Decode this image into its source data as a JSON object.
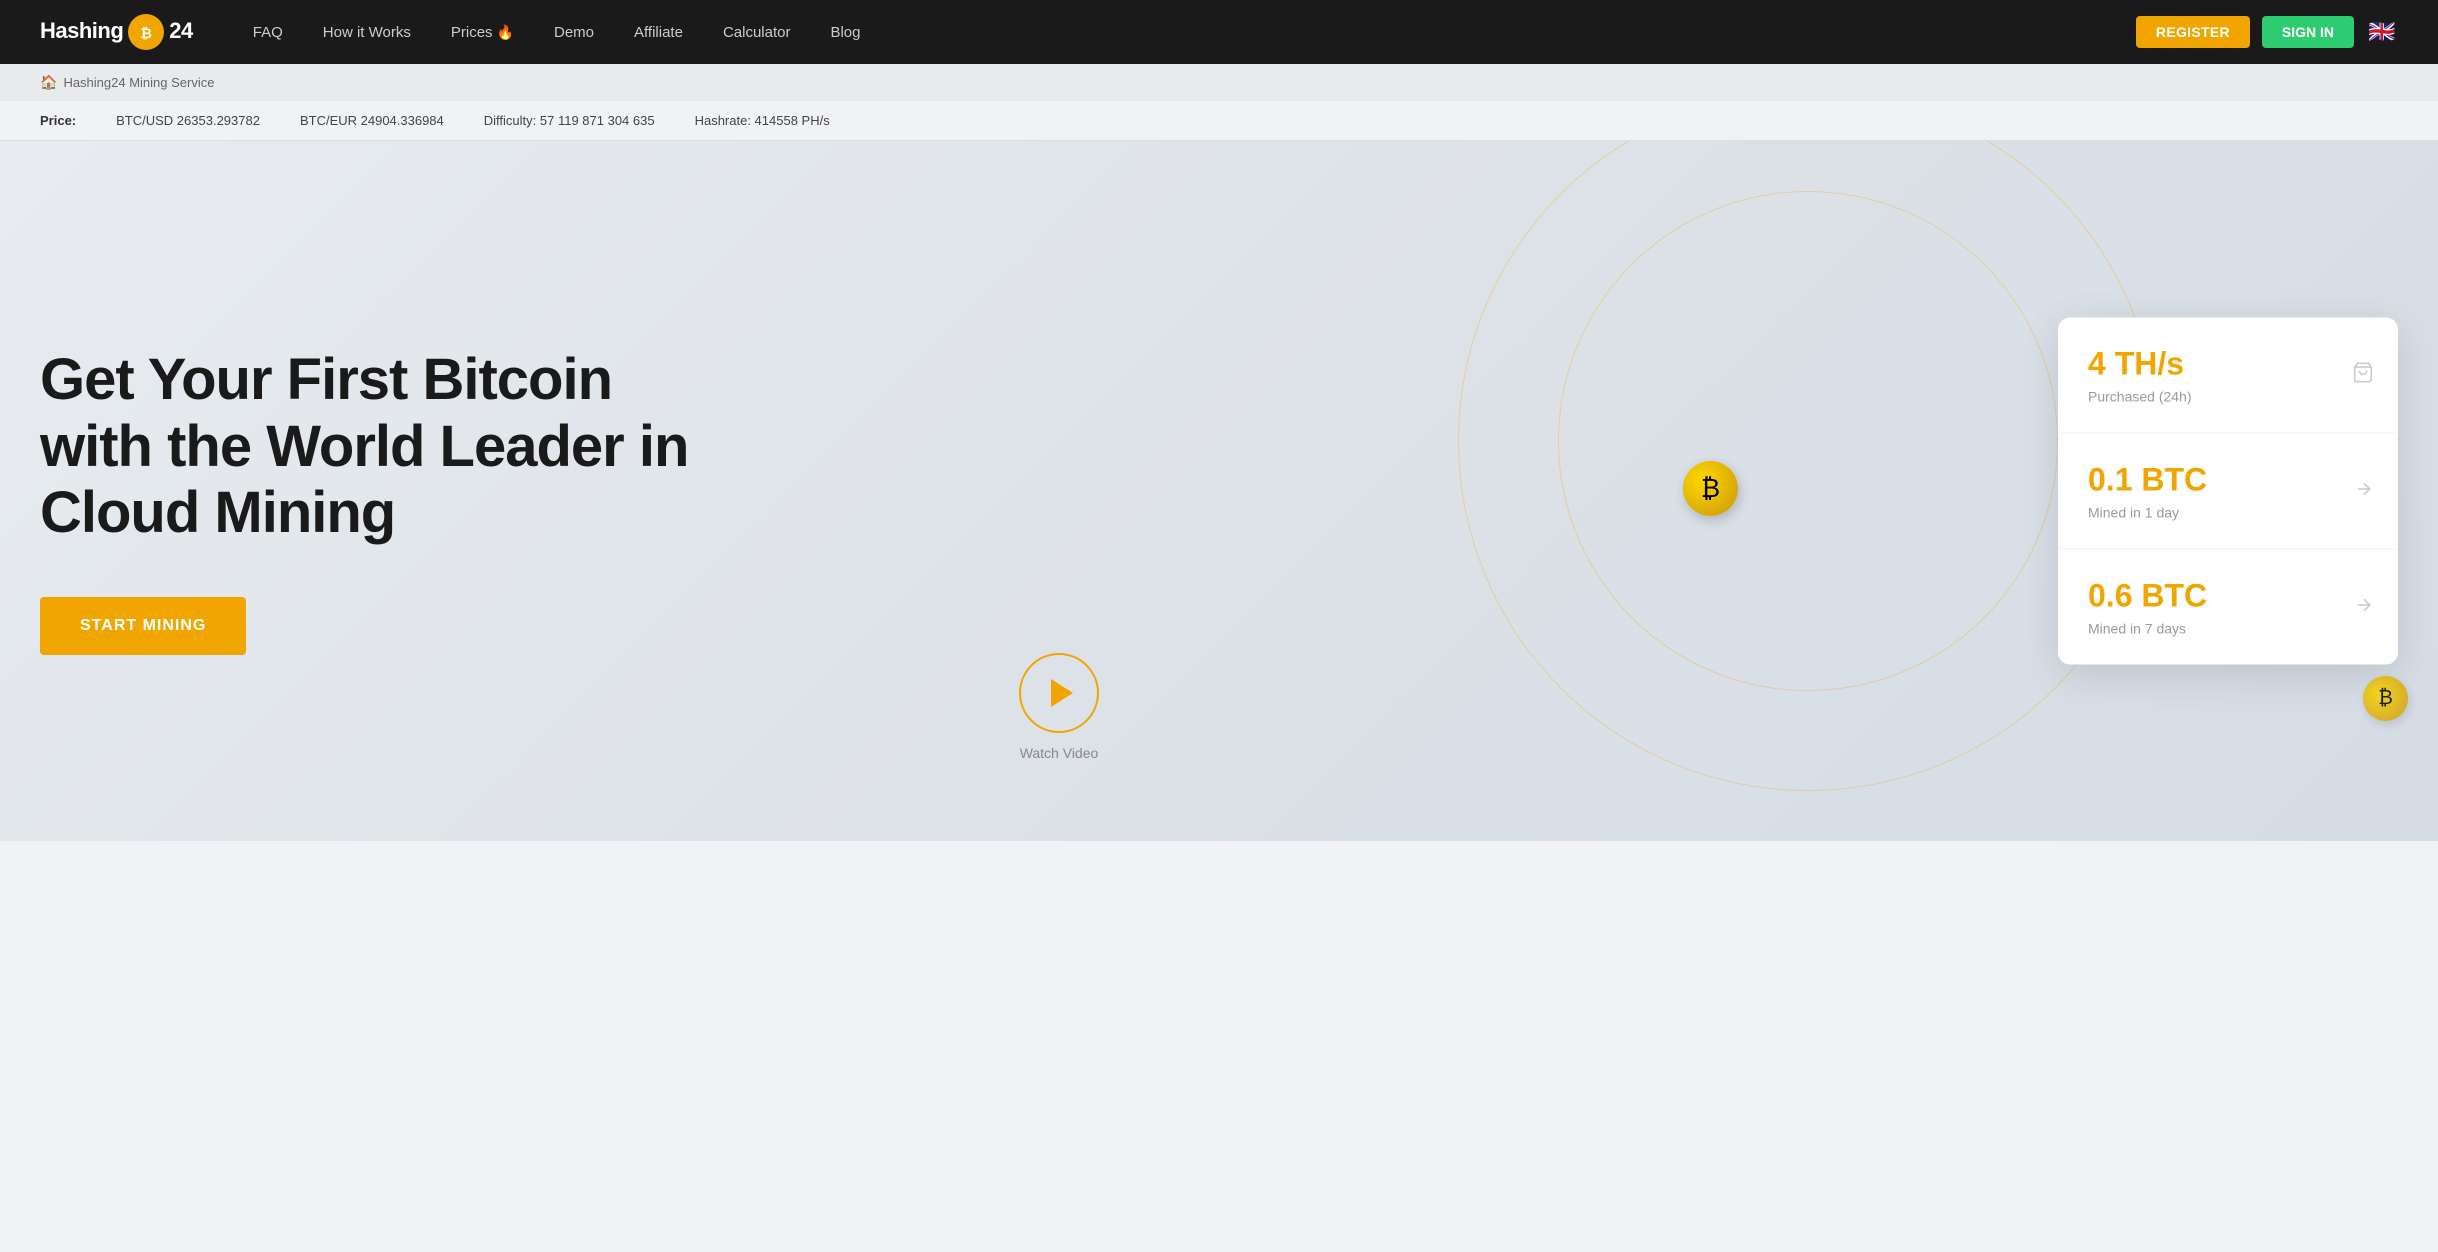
{
  "navbar": {
    "logo_text": "Hashing",
    "logo_suffix": "24",
    "nav_links": [
      {
        "id": "faq",
        "label": "FAQ",
        "has_fire": false
      },
      {
        "id": "how-it-works",
        "label": "How it Works",
        "has_fire": false
      },
      {
        "id": "prices",
        "label": "Prices",
        "has_fire": true
      },
      {
        "id": "demo",
        "label": "Demo",
        "has_fire": false
      },
      {
        "id": "affiliate",
        "label": "Affiliate",
        "has_fire": false
      },
      {
        "id": "calculator",
        "label": "Calculator",
        "has_fire": false
      },
      {
        "id": "blog",
        "label": "Blog",
        "has_fire": false
      }
    ],
    "register_label": "REGISTER",
    "signin_label": "SIGN IN",
    "lang_flag": "🇬🇧"
  },
  "breadcrumb": {
    "home_text": "Hashing24 Mining Service"
  },
  "ticker": {
    "price_label": "Price:",
    "btc_usd": "BTC/USD 26353.293782",
    "btc_eur": "BTC/EUR 24904.336984",
    "difficulty": "Difficulty: 57 119 871 304 635",
    "hashrate": "Hashrate: 414558 PH/s"
  },
  "hero": {
    "title_line1": "Get Your First Bitcoin",
    "title_line2": "with the World Leader in",
    "title_line3": "Cloud Mining",
    "start_button": "START MINING",
    "watch_video": "Watch Video"
  },
  "stats": [
    {
      "value": "4 TH/s",
      "label": "Purchased (24h)",
      "icon_type": "cart"
    },
    {
      "value": "0.1 BTC",
      "label": "Mined in 1 day",
      "icon_type": "arrow"
    },
    {
      "value": "0.6 BTC",
      "label": "Mined in 7 days",
      "icon_type": "arrow"
    }
  ]
}
